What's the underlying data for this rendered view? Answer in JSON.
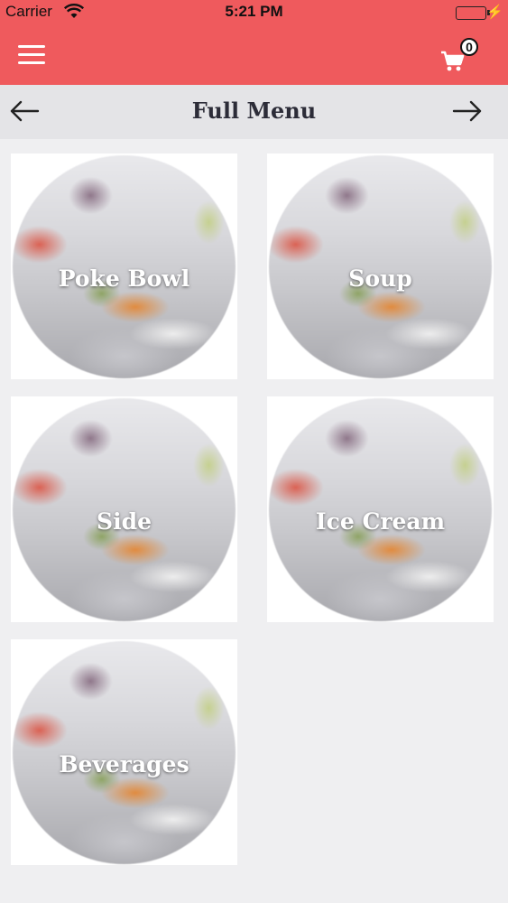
{
  "status_bar": {
    "carrier": "Carrier",
    "time": "5:21 PM"
  },
  "header": {
    "menu_icon": "hamburger-menu-icon",
    "cart_icon": "shopping-cart-icon",
    "cart_count": "0",
    "accent_color": "#ef5a5d"
  },
  "title_bar": {
    "title": "Full Menu",
    "prev_icon": "arrow-left-icon",
    "next_icon": "arrow-right-icon"
  },
  "menu": {
    "items": [
      {
        "label": "Poke Bowl"
      },
      {
        "label": "Soup"
      },
      {
        "label": "Side"
      },
      {
        "label": "Ice Cream"
      },
      {
        "label": "Beverages"
      }
    ]
  }
}
